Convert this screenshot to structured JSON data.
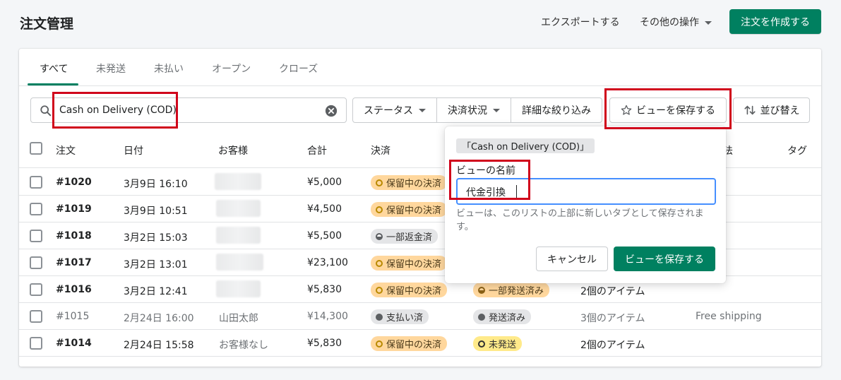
{
  "header": {
    "title": "注文管理",
    "export_label": "エクスポートする",
    "more_label": "その他の操作",
    "create_label": "注文を作成する"
  },
  "tabs": [
    {
      "label": "すべて",
      "active": true
    },
    {
      "label": "未発送"
    },
    {
      "label": "未払い"
    },
    {
      "label": "オープン"
    },
    {
      "label": "クローズ"
    }
  ],
  "search": {
    "value": "Cash on Delivery (COD)"
  },
  "filters": {
    "status_label": "ステータス",
    "payment_label": "決済状況",
    "detail_label": "詳細な絞り込み",
    "save_view_label": "ビューを保存する",
    "sort_label": "並び替え"
  },
  "table": {
    "columns": {
      "order": "注文",
      "date": "日付",
      "customer": "お客様",
      "total": "合計",
      "payment": "決済",
      "method_partial": "法",
      "tags": "タグ"
    },
    "rows": [
      {
        "order": "#1020",
        "date": "3月9日 16:10",
        "customer": "",
        "total": "¥5,000",
        "payment": "保留中の決済",
        "fulfillment": "",
        "items": "",
        "delivery": ""
      },
      {
        "order": "#1019",
        "date": "3月9日 10:51",
        "customer": "",
        "total": "¥4,500",
        "payment": "保留中の決済",
        "fulfillment": "",
        "items": "",
        "delivery": ""
      },
      {
        "order": "#1018",
        "date": "3月2日 15:03",
        "customer": "",
        "total": "¥5,500",
        "payment": "一部返金済",
        "fulfillment": "",
        "items": "",
        "delivery": ""
      },
      {
        "order": "#1017",
        "date": "3月2日 13:01",
        "customer": "",
        "total": "¥23,100",
        "payment": "保留中の決済",
        "fulfillment": "",
        "items": "",
        "delivery": ""
      },
      {
        "order": "#1016",
        "date": "3月2日 12:41",
        "customer": "",
        "total": "¥5,830",
        "payment": "保留中の決済",
        "fulfillment": "一部発送済み",
        "items": "2個のアイテム",
        "delivery": ""
      },
      {
        "order": "#1015",
        "date": "2月24日 16:00",
        "customer": "山田太郎",
        "total": "¥14,300",
        "payment": "支払い済",
        "fulfillment": "発送済み",
        "items": "3個のアイテム",
        "delivery": "Free shipping"
      },
      {
        "order": "#1014",
        "date": "2月24日 15:58",
        "customer": "お客様なし",
        "total": "¥5,830",
        "payment": "保留中の決済",
        "fulfillment": "未発送",
        "items": "2個のアイテム",
        "delivery": ""
      }
    ]
  },
  "popover": {
    "filter_tag": "「Cash on Delivery (COD)」",
    "name_label": "ビューの名前",
    "name_value": "代金引換",
    "help_text": "ビューは、このリストの上部に新しいタブとして保存されます。",
    "cancel_label": "キャンセル",
    "save_label": "ビューを保存する"
  },
  "colors": {
    "primary": "#008060",
    "highlight": "#d0021b",
    "focus": "#458fff"
  }
}
